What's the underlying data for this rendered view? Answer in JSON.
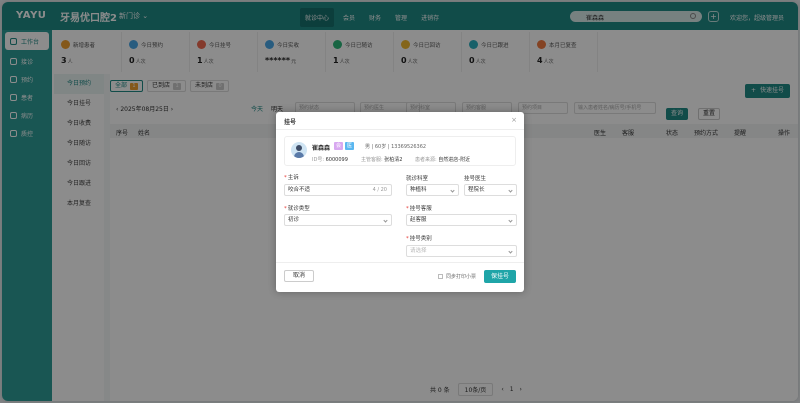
{
  "topbar": {
    "logo": "YAYU",
    "clinic_name": "牙易优口腔2",
    "store": "新门诊",
    "nav": [
      "就诊中心",
      "会员",
      "财务",
      "管理",
      "进销存"
    ],
    "search_value": "崔森森",
    "welcome": "欢迎您，超级管理员"
  },
  "sidebar": {
    "items": [
      {
        "label": "工作台",
        "icon": "home-icon"
      },
      {
        "label": "接诊",
        "icon": "star-icon"
      },
      {
        "label": "预约",
        "icon": "calendar-icon"
      },
      {
        "label": "患者",
        "icon": "user-icon"
      },
      {
        "label": "病历",
        "icon": "file-icon"
      },
      {
        "label": "质控",
        "icon": "shield-icon"
      }
    ]
  },
  "stats": [
    {
      "label": "新增患者",
      "value": "3",
      "unit": "人",
      "color": "#f0a030"
    },
    {
      "label": "今日预约",
      "value": "0",
      "unit": "人次",
      "color": "#4aa8e8"
    },
    {
      "label": "今日挂号",
      "value": "1",
      "unit": "人次",
      "color": "#f06a50"
    },
    {
      "label": "今日实收",
      "value": "******",
      "unit": "元",
      "color": "#4aa8e8"
    },
    {
      "label": "今日已随访",
      "value": "1",
      "unit": "人次",
      "color": "#2cb87a"
    },
    {
      "label": "今日已回访",
      "value": "0",
      "unit": "人次",
      "color": "#f0b830"
    },
    {
      "label": "今日已跟进",
      "value": "0",
      "unit": "人次",
      "color": "#2cb0c0"
    },
    {
      "label": "本月已复查",
      "value": "4",
      "unit": "人次",
      "color": "#f07a40"
    }
  ],
  "leftnav": [
    "今日预约",
    "今日挂号",
    "今日收费",
    "今日随访",
    "今日回访",
    "今日跟进",
    "本月复查"
  ],
  "tabs": [
    {
      "label": "全部",
      "count": "1"
    },
    {
      "label": "已到店",
      "count": "1"
    },
    {
      "label": "未到店",
      "count": "0"
    }
  ],
  "quick_register": "快速挂号",
  "filter": {
    "date": "2025年08月25日",
    "today": "今天",
    "tomorrow": "明天",
    "f1": "预约状态",
    "f2": "预约医生",
    "f3": "预约科室",
    "f4": "预约客服",
    "f5": "预约项目",
    "search_ph": "输入患者姓名/病历号/手机号",
    "search_btn": "查询",
    "reset_btn": "重置"
  },
  "table_headers": [
    "序号",
    "姓名",
    "医生",
    "客服",
    "状态",
    "预约方式",
    "提醒",
    "操作"
  ],
  "pager": {
    "total": "共 0 条",
    "size": "10条/页",
    "page": "1"
  },
  "modal": {
    "title": "挂号",
    "patient": {
      "name": "崔森森",
      "tag1": "会",
      "tag2": "医",
      "info": "男 | 60岁 | 13369526362",
      "id_label": "ID号:",
      "id": "6000099",
      "service_label": "主管客服:",
      "service": "张柏清2",
      "source_label": "患者来源:",
      "source": "自然进店-附近"
    },
    "chief_label": "主诉",
    "chief_value": "咬合不适",
    "chief_count": "4 / 20",
    "dept_label": "就诊科室",
    "dept_value": "种植科",
    "doctor_label": "挂号医生",
    "doctor_value": "程院长",
    "visit_type_label": "就诊类型",
    "visit_type_value": "初诊",
    "reg_service_label": "挂号客服",
    "reg_service_value": "赵客服",
    "reg_type_label": "挂号类别",
    "reg_type_placeholder": "请选择",
    "cancel": "取消",
    "print_sync": "同步打印小票",
    "save": "保挂号"
  }
}
